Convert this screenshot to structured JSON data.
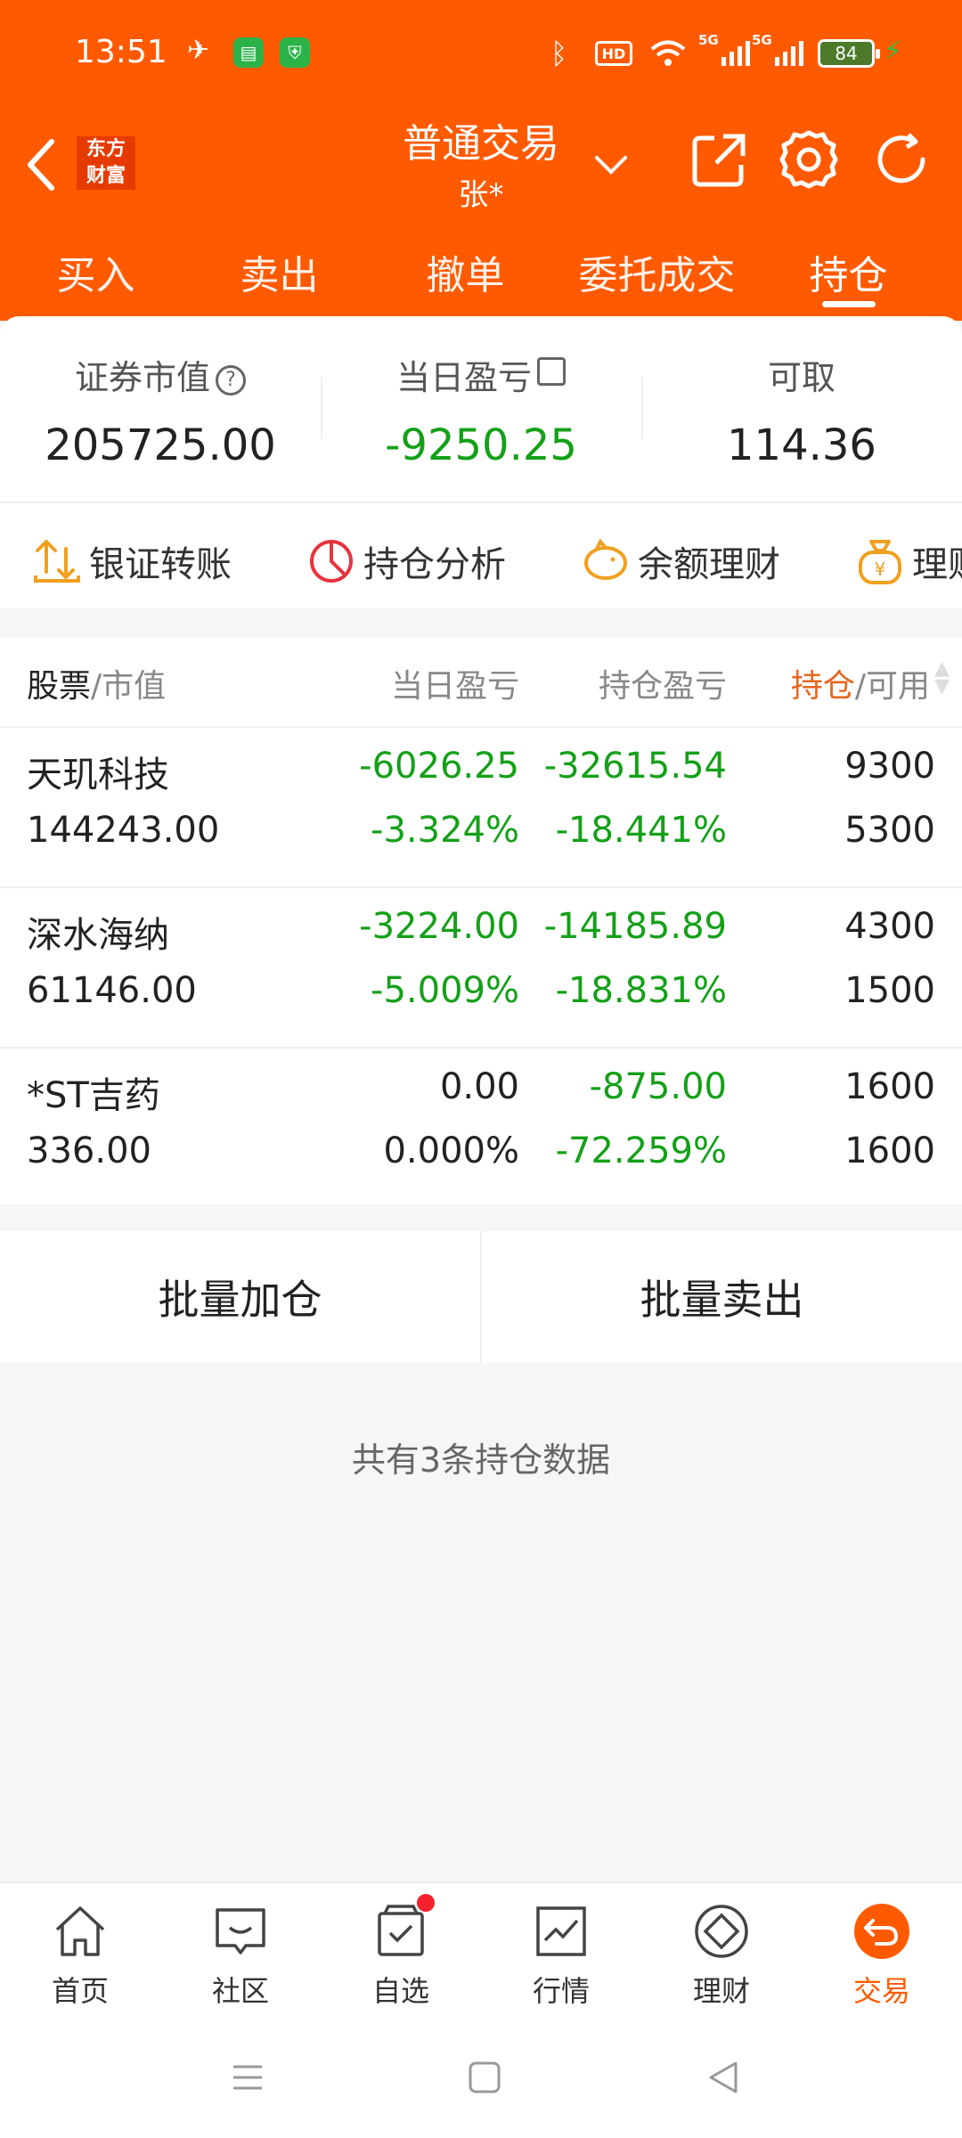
{
  "status_bar": {
    "time": "13:51",
    "battery": "84",
    "hd": "HD",
    "sig1": "5G",
    "sig2": "5G"
  },
  "header": {
    "logo_line1": "东方",
    "logo_line2": "财富",
    "title": "普通交易",
    "account": "张*"
  },
  "tabs": [
    {
      "label": "买入"
    },
    {
      "label": "卖出"
    },
    {
      "label": "撤单"
    },
    {
      "label": "委托成交"
    },
    {
      "label": "持仓",
      "active": true
    }
  ],
  "summary": {
    "market_value_label": "证券市值",
    "market_value": "205725.00",
    "daily_pl_label": "当日盈亏",
    "daily_pl": "-9250.25",
    "withdrawable_label": "可取",
    "withdrawable": "114.36"
  },
  "tools": [
    {
      "label": "银证转账",
      "icon": "transfer-icon"
    },
    {
      "label": "持仓分析",
      "icon": "pie-chart-icon"
    },
    {
      "label": "余额理财",
      "icon": "piggy-bank-icon"
    },
    {
      "label": "理财",
      "icon": "money-bag-icon"
    }
  ],
  "table": {
    "col_stock": "股票",
    "col_stock_sub": "/市值",
    "col_daily": "当日盈亏",
    "col_position_pl": "持仓盈亏",
    "col_hold": "持仓",
    "col_hold_sub": "/可用",
    "rows": [
      {
        "name": "天玑科技",
        "market_value": "144243.00",
        "daily_pl": "-6026.25",
        "daily_pct": "-3.324%",
        "pos_pl": "-32615.54",
        "pos_pct": "-18.441%",
        "hold": "9300",
        "available": "5300"
      },
      {
        "name": "深水海纳",
        "market_value": "61146.00",
        "daily_pl": "-3224.00",
        "daily_pct": "-5.009%",
        "pos_pl": "-14185.89",
        "pos_pct": "-18.831%",
        "hold": "4300",
        "available": "1500"
      },
      {
        "name": "*ST吉药",
        "market_value": "336.00",
        "daily_pl": "0.00",
        "daily_pct": "0.000%",
        "pos_pl": "-875.00",
        "pos_pct": "-72.259%",
        "hold": "1600",
        "available": "1600"
      }
    ]
  },
  "batch": {
    "add": "批量加仓",
    "sell": "批量卖出"
  },
  "count_text": "共有3条持仓数据",
  "bottom_nav": [
    {
      "label": "首页",
      "icon": "home-icon"
    },
    {
      "label": "社区",
      "icon": "community-icon"
    },
    {
      "label": "自选",
      "icon": "watchlist-icon"
    },
    {
      "label": "行情",
      "icon": "market-icon"
    },
    {
      "label": "理财",
      "icon": "wealth-icon"
    },
    {
      "label": "交易",
      "icon": "trade-icon",
      "active": true
    }
  ],
  "colors": {
    "brand": "#ff5a00",
    "loss": "#14a018",
    "text": "#222222"
  }
}
